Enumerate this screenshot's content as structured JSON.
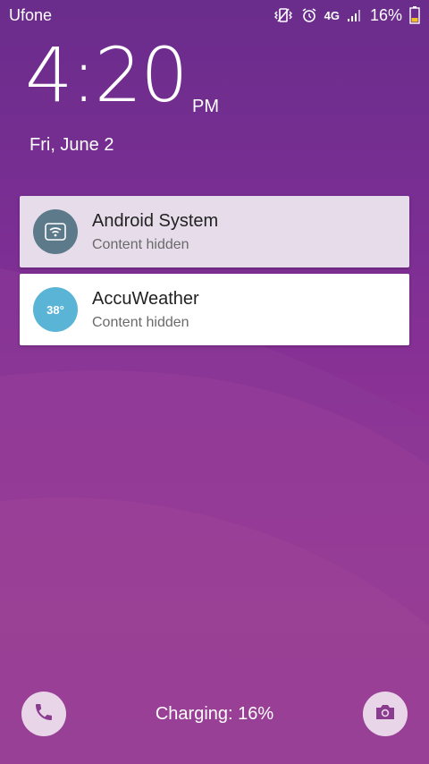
{
  "status_bar": {
    "carrier": "Ufone",
    "network": "4G",
    "battery_percent": "16%",
    "icons": [
      "vibrate-icon",
      "alarm-icon",
      "network-4g-icon",
      "signal-icon",
      "battery-icon"
    ]
  },
  "clock": {
    "time": "4:20",
    "ampm": "PM",
    "date": "Fri, June 2"
  },
  "notifications": [
    {
      "app": "Android System",
      "text": "Content hidden",
      "icon": "wifi-icon"
    },
    {
      "app": "AccuWeather",
      "text": "Content hidden",
      "icon": "weather-temp-icon",
      "icon_text": "38°"
    }
  ],
  "bottom": {
    "charging_text": "Charging: 16%",
    "left_shortcut": "phone-icon",
    "right_shortcut": "camera-icon"
  },
  "colors": {
    "wallpaper": "#7e2f95",
    "system_icon_bg": "#5d7a8a",
    "weather_icon_bg": "#5ab4d6"
  }
}
